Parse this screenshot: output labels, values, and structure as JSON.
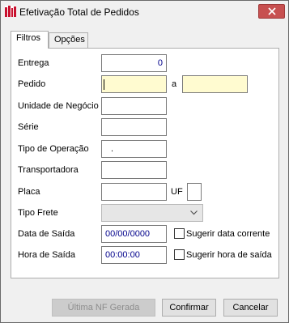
{
  "window": {
    "title": "Efetivação Total de Pedidos"
  },
  "tabs": [
    {
      "label": "Filtros"
    },
    {
      "label": "Opções"
    }
  ],
  "form": {
    "entrega": {
      "label": "Entrega",
      "value": "0"
    },
    "pedido": {
      "label": "Pedido",
      "from_value": "",
      "range_sep": "a",
      "to_value": ""
    },
    "unidade": {
      "label": "Unidade de Negócio",
      "value": ""
    },
    "serie": {
      "label": "Série",
      "value": ""
    },
    "tipo_operacao": {
      "label": "Tipo de Operação",
      "value": "."
    },
    "transportadora": {
      "label": "Transportadora",
      "value": ""
    },
    "placa": {
      "label": "Placa",
      "value": "",
      "uf_label": "UF",
      "uf_value": ""
    },
    "tipo_frete": {
      "label": "Tipo Frete",
      "value": ""
    },
    "data_saida": {
      "label": "Data de Saída",
      "value": "00/00/0000",
      "check_label": "Sugerir data corrente",
      "checked": false
    },
    "hora_saida": {
      "label": "Hora de Saída",
      "value": "00:00:00",
      "check_label": "Sugerir hora de saída",
      "checked": false
    }
  },
  "buttons": {
    "ultima": {
      "label": "Última NF Gerada",
      "enabled": false
    },
    "confirmar": {
      "label": "Confirmar"
    },
    "cancelar": {
      "label": "Cancelar"
    }
  },
  "colors": {
    "required_field": "#fffbd0",
    "close_button": "#c75050",
    "value_text": "#00008b"
  },
  "icons": {
    "app": "app-logo-icon",
    "close": "close-icon",
    "dropdown": "chevron-down-icon"
  }
}
